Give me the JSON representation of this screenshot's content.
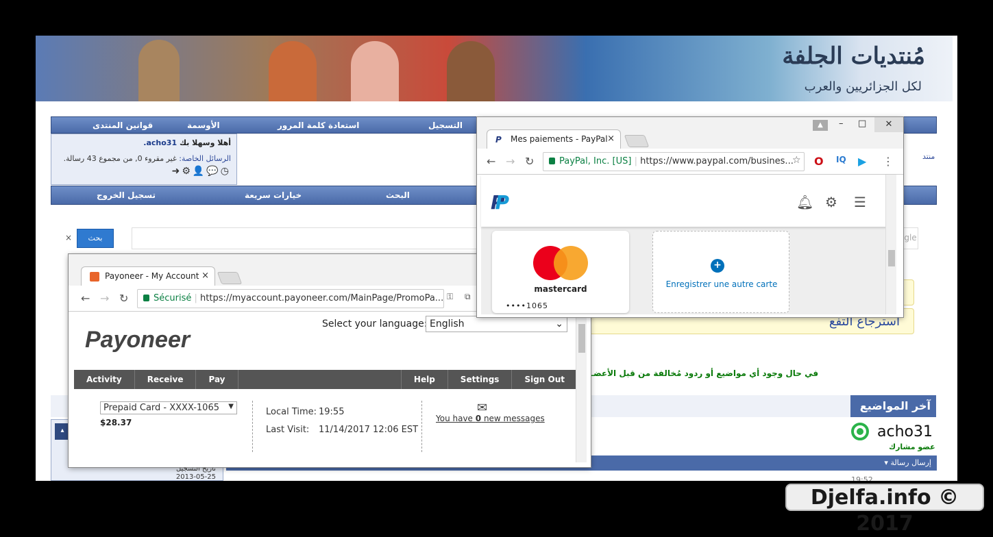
{
  "forum": {
    "logo_text": "مُنتديات الجلفة",
    "logo_sub": "لكل الجزائريين والعرب",
    "nav": [
      "قوانين المنتدى",
      "الأوسمة",
      "استعادة كلمة المرور",
      "التسجيل"
    ],
    "welcome_prefix": "أهلا وسهلا بك",
    "username": "acho31.",
    "pm_label": "الرسائل الخاصة:",
    "pm_text": "غير مقروء 0, من مجموع 43 رسالة.",
    "nav2": [
      "تسجيل الخروج",
      "خيارات سريعة",
      "البحث"
    ],
    "search_button": "بحث",
    "search_close": "×",
    "google_tag": "ogle",
    "yellow_text": "استرجاع التفع",
    "notice": "في حال وجود أي مواضيع أو ردود مُخالفة من قبل الأعضـ",
    "last_topics": "آخر المواضيع",
    "profile_name": "acho31",
    "profile_rank": "عضو مشارك",
    "send_message": "إرسال رسالة",
    "reg_label": "تاريخ التسجيل",
    "reg_date": "2013-05-25",
    "time_fragment": "19:52",
    "side_fragment": "منتد"
  },
  "payoneer": {
    "tab_title": "Payoneer - My Account",
    "secure_label": "Sécurisé",
    "url": "https://myaccount.payoneer.com/MainPage/PromoPa...",
    "logo": "Payoneer",
    "lang_label": "Select your language:",
    "lang_value": "English",
    "nav_left": [
      "Activity",
      "Receive",
      "Pay"
    ],
    "nav_right": [
      "Help",
      "Settings",
      "Sign Out"
    ],
    "card_select": "Prepaid Card - XXXX-1065",
    "balance": "$28.37",
    "local_time_label": "Local Time:",
    "local_time_value": "19:55",
    "last_visit_label": "Last Visit:",
    "last_visit_value": "11/14/2017 12:06 EST",
    "messages_prefix": "You have ",
    "messages_count": "0",
    "messages_suffix": " new messages"
  },
  "paypal": {
    "tab_title": "Mes paiements - PayPal",
    "secure_label": "PayPal, Inc. [US]",
    "url": "https://www.paypal.com/busines...",
    "card_brand": "mastercard",
    "card_number": "••••1065",
    "add_card": "Enregistrer une autre carte"
  },
  "watermark": "Djelfa.info © 2017",
  "colors": {
    "forum_nav": "#4a6aa8",
    "payoneer_orange": "#e8642a",
    "paypal_blue": "#0070ba",
    "mastercard_red": "#eb001b",
    "mastercard_orange": "#f79e1b"
  }
}
